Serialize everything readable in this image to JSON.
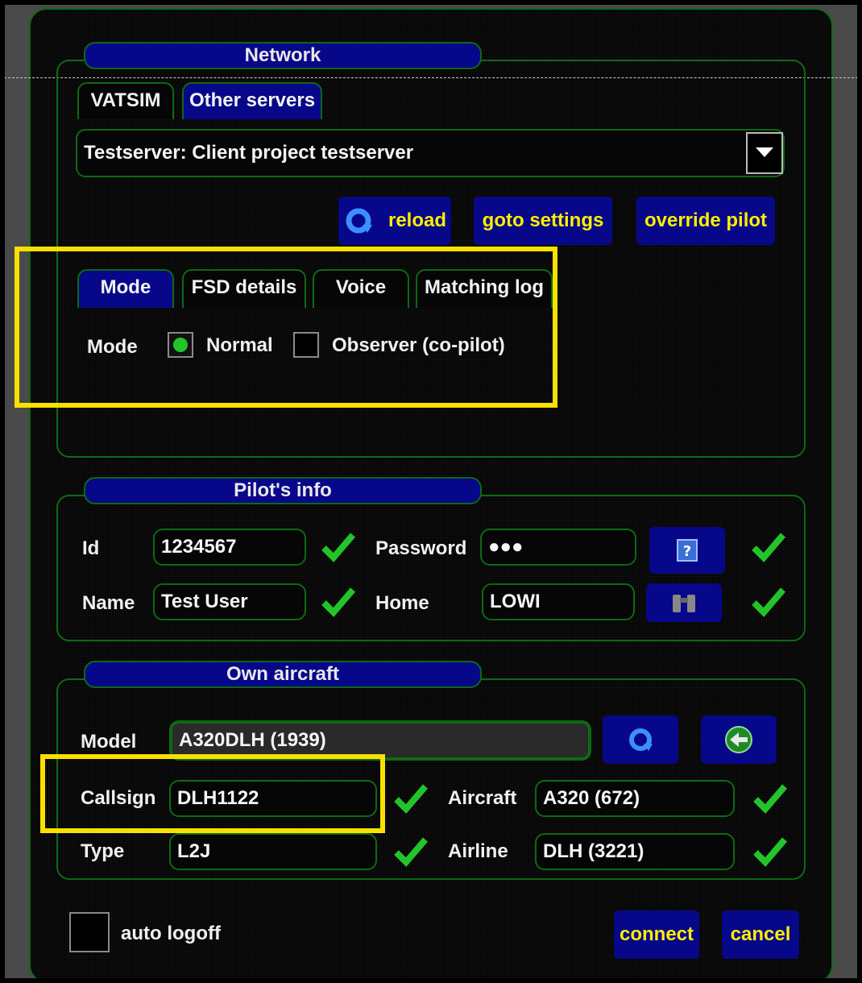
{
  "network": {
    "title": "Network",
    "tabs": [
      "VATSIM",
      "Other servers"
    ],
    "server_selected": "Testserver: Client project testserver",
    "buttons": {
      "reload": "reload",
      "goto_settings": "goto settings",
      "override_pilot": "override pilot"
    },
    "subtabs": [
      "Mode",
      "FSD details",
      "Voice",
      "Matching log"
    ],
    "mode_label": "Mode",
    "mode_options": [
      "Normal",
      "Observer (co-pilot)"
    ],
    "mode_selected": "Normal"
  },
  "pilot": {
    "title": "Pilot's info",
    "id_label": "Id",
    "id_value": "1234567",
    "password_label": "Password",
    "password_value": "●●●",
    "name_label": "Name",
    "name_value": "Test User",
    "home_label": "Home",
    "home_value": "LOWI"
  },
  "aircraft": {
    "title": "Own aircraft",
    "model_label": "Model",
    "model_value": "A320DLH (1939)",
    "callsign_label": "Callsign",
    "callsign_value": "DLH1122",
    "aircraft_label": "Aircraft",
    "aircraft_value": "A320 (672)",
    "type_label": "Type",
    "type_value": "L2J",
    "airline_label": "Airline",
    "airline_value": "DLH (3221)"
  },
  "footer": {
    "auto_logoff": "auto logoff",
    "connect": "connect",
    "cancel": "cancel"
  },
  "colors": {
    "panel_blue": "#07078a",
    "frame_green": "#0c6a12",
    "button_text": "#ffee00",
    "highlight": "#f8e000",
    "check_green": "#22c42a"
  },
  "icons": [
    "dropdown-arrow-icon",
    "reload-icon",
    "help-icon",
    "binoculars-icon",
    "refresh-icon",
    "back-icon",
    "checkmark-icon"
  ]
}
